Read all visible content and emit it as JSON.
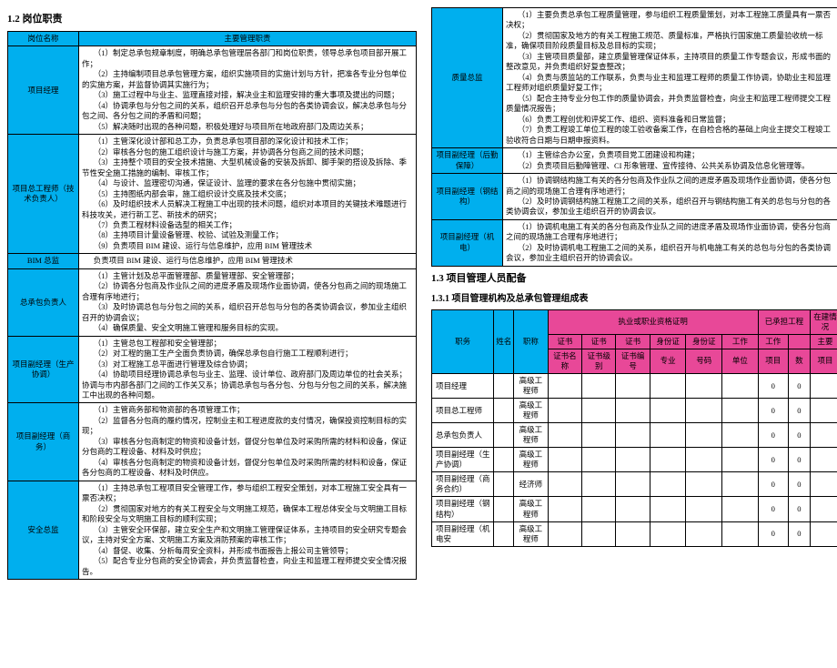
{
  "headings": {
    "h1_2": "1.2 岗位职责",
    "h1_3": "1.3 项目管理人员配备",
    "h1_3_1": "1.3.1 项目管理机构及总承包管理组成表"
  },
  "duties_header": {
    "col1": "岗位名称",
    "col2": "主要管理职责"
  },
  "duties_left": [
    {
      "role": "项目经理",
      "items": [
        "（1）制定总承包规章制度，明确总承包管理层各部门和岗位职责，领导总承包项目部开展工作；",
        "（2）主持编制项目总承包管理方案，组织实施项目的实施计划与方针，把准各专业分包单位的实施方案，并监督协调其实施行为；",
        "（3）施工过程中与业主、监理直接对接，解决业主和监理安排的重大事项及提出的问题；",
        "（4）协调承包与分包之间的关系，组织召开总承包与分包的各类协调会议，解决总承包与分包之间、各分包之间的矛盾和问题；",
        "（5）解决随时出现的各种问题，积极处理好与项目所在地政府部门及周边关系；"
      ]
    },
    {
      "role": "项目总工程师（技术负责人）",
      "items": [
        "（1）主管深化设计部和总工办，负责总承包项目部的深化设计和技术工作；",
        "（2）审核各分包的施工组织设计与施工方案，并协调各分包商之间的技术问题；",
        "（3）主持整个项目的安全技术措施、大型机械设备的安装及拆卸、脚手架的搭设及拆除、季节性安全施工措施的编制、审核工作；",
        "（4）与设计、监理密切沟通，保证设计、监理的要求在各分包施中贯彻实施；",
        "（5）主持图纸内部会审，施工组织设计交底及技术交底；",
        "（6）及时组织技术人员解决工程施工中出现的技术问题，组织对本项目的关键技术难题进行科技攻关，进行新工艺、新技术的研究；",
        "（7）负责工程材料设备选型的相关工作；",
        "（8）主持项目计量设备管理、校验、试验及测量工作；",
        "（9）负责项目 BIM 建设、运行与信息维护，应用 BIM 管理技术"
      ]
    },
    {
      "role": "BIM 总监",
      "items": [
        "负责项目 BIM 建设、运行与信息维护，应用 BIM 管理技术"
      ]
    },
    {
      "role": "总承包负责人",
      "items": [
        "（1）主管计划及总平面管理部、质量管理部、安全管理部；",
        "（2）协调各分包商及作业队之间的进度矛盾及现场作业面协调，使各分包商之间的现场施工合理有序地进行；",
        "（3）及时协调总包与分包之间的关系，组织召开总包与分包的各类协调会议，参加业主组织召开的协调会议；",
        "（4）确保质量、安全文明施工管理和服务目标的实现。"
      ]
    },
    {
      "role": "项目副经理（生产协调）",
      "items": [
        "（1）主管总包工程部和安全管理部；",
        "（2）对工程的施工生产全面负责协调，确保总承包自行施工工程顺利进行；",
        "（3）对工程施工总平面进行管理及综合协调；",
        "（4）协助项目经理协调总承包与业主、监理、设计单位、政府部门及周边单位的社会关系；协调与市内部各部门之间的工作关又系；协调总承包与各分包、分包与分包之间的关系，解决施工中出现的各种问题。"
      ]
    },
    {
      "role": "项目副经理（商务）",
      "items": [
        "（1）主管商务部和物资部的各项管理工作；",
        "（2）监督各分包商的履约情况，控制业主和工程进度款的支付情况，确保投资控制目标的实现；",
        "（3）审核各分包商制定的物资和设备计划，督促分包单位及时采购所需的材料和设备，保证分包商的工程设备、材料及时供应；",
        "（4）审核各分包商制定的物资和设备计划，督促分包单位及时采购所需的材料和设备，保证各分包商的工程设备、材料及时供应。"
      ]
    },
    {
      "role": "安全总监",
      "items": [
        "（1）主持总承包工程项目安全管理工作，参与组织工程安全策划，对本工程施工安全具有一票否决权；",
        "（2）贯彻国家对地方的有关工程安全与文明施工规范，确保本工程总体安全与文明施工目标和阶段安全与文明施工目标的顺利实现；",
        "（3）主管安全环保部，建立安全生产和文明施工管理保证体系，主持项目的安全研究专题会议，主持对安全方案、文明施工方案及消防预案的审核工作；",
        "（4）督促、收集、分析每周安全资料，并形成书面报告上报公司主管领导；",
        "（5）配合专业分包商的安全协调会，并负责监督检查，向业主和监理工程师提交安全情况报告。"
      ]
    }
  ],
  "duties_right": [
    {
      "role": "质量总监",
      "items": [
        "（1）主要负责总承包工程质量管理，参与组织工程质量策划，对本工程施工质量具有一票否决权；",
        "（2）贯彻国家及地方的有关工程施工规范、质量标准，严格执行国家施工质量验收统一标准，确保项目阶段质量目标及总目标的实现；",
        "（3）主管项目质量部，建立质量管理保证体系，主持项目的质量工作专题会议，形成书面的整改意见，并负责组织好复查整改；",
        "（4）负责与质监站的工作联系，负责与业主和监理工程师的质量工作协调，协助业主和监理工程师对组织质量好复工作；",
        "（5）配合主持专业分包工作的质量协调会，并负责监督检查，向业主和监理工程师提交工程质量情况报告；",
        "（6）负责工程创优和评奖工作、组织、资料准备和日常监督；",
        "（7）负责工程竣工单位工程的竣工验收备案工作，在自检合格的基础上向业主提交工程竣工验收符合日期与日期申报资料。"
      ]
    },
    {
      "role": "项目副经理（后勤保障）",
      "items": [
        "（1）主管综合办公室，负责项目党工团建设和构建；",
        "（2）负责项目后勤障管理、CI 形象管理、宣传接待、公共关系协调及信息化管理等。"
      ]
    },
    {
      "role": "项目副经理（钢结构）",
      "items": [
        "（1）协调钢结构施工有关的各分包商及作业队之间的进度矛盾及现场作业面协调，使各分包商之间的现场施工合理有序地进行；",
        "（2）及时协调钢结构施工程施工之间的关系，组织召开与钢结构施工有关的总包与分包的各类协调会议，参加业主组织召开的协调会议。"
      ]
    },
    {
      "role": "项目副经理（机电）",
      "items": [
        "（1）协调机电施工有关的各分包商及作业队之间的进度矛盾及现场作业面协调，使各分包商之间的现场施工合理有序地进行；",
        "（2）及时协调机电工程施工之间的关系，组织召开与机电施工有关的总包与分包的各类协调会议，参加业主组织召开的协调会议。"
      ]
    }
  ],
  "staff_header": {
    "group1": "执业或职业资格证明",
    "group2": "已承担工程",
    "group3": "在建情况",
    "role": "职务",
    "name": "姓名",
    "title": "职称",
    "cert_name": "证书名称",
    "cert_level": "证书级别",
    "cert_no": "证书编号",
    "id_major": "身份证专业",
    "id_no": "身份证号码",
    "work_unit": "工作单位",
    "proj": "项目",
    "count": "数",
    "main": "主要项目"
  },
  "staff_rows": [
    {
      "role": "项目经理",
      "title": "高级工程师",
      "proj": "0",
      "count": "0"
    },
    {
      "role": "项目总工程师",
      "title": "高级工程师",
      "proj": "0",
      "count": "0"
    },
    {
      "role": "总承包负责人",
      "title": "高级工程师",
      "proj": "0",
      "count": "0"
    },
    {
      "role": "项目副经理（生产协调）",
      "title": "高级工程师",
      "proj": "0",
      "count": "0"
    },
    {
      "role": "项目副经理（商务合约）",
      "title": "经济师",
      "proj": "0",
      "count": "0"
    },
    {
      "role": "项目副经理（钢结构）",
      "title": "高级工程师",
      "proj": "0",
      "count": "0"
    },
    {
      "role": "项目副经理（机电安",
      "title": "高级工程师",
      "proj": "0",
      "count": "0"
    }
  ]
}
